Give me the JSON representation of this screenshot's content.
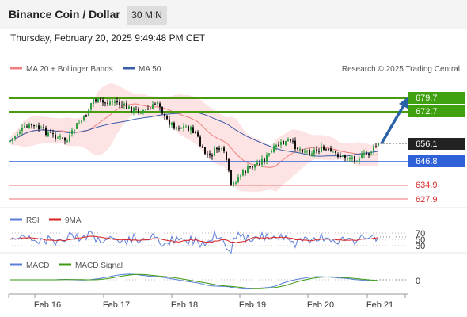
{
  "header": {
    "title": "Binance Coin / Dollar",
    "timeframe": "30 MIN"
  },
  "datetime": "Thursday, February 20, 2025 9:49:48 PM CET",
  "legend": {
    "ma20_label": "MA 20 + Bollinger Bands",
    "ma50_label": "MA 50",
    "credit": "Research © 2025 Trading Central"
  },
  "colors": {
    "up": "#2e9e44",
    "down": "#111111",
    "ma20": "#f08080",
    "ma50": "#3a5ba8",
    "resistance": "#4a9a10",
    "support": "#2f62d8",
    "support_red": "#f4a0a0",
    "arrow": "#2a62a8",
    "rsi": "#5a7dd8",
    "nine_ma": "#d92020",
    "macd": "#5a7dd8",
    "macd_signal": "#3a9a10"
  },
  "chart_data": [
    {
      "type": "candlestick",
      "x_ticks": [
        "Feb 16",
        "Feb 17",
        "Feb 18",
        "Feb 19",
        "Feb 20",
        "Feb 21"
      ],
      "resistance_levels": [
        {
          "label": "679.7",
          "value": 679.7
        },
        {
          "label": "672.7",
          "value": 672.7
        }
      ],
      "current_price": {
        "label": "656.1",
        "value": 656.1
      },
      "support_levels": [
        {
          "label": "646.8",
          "value": 646.8
        },
        {
          "label": "634.9",
          "value": 634.9
        },
        {
          "label": "627.9",
          "value": 627.9
        }
      ],
      "series": [
        {
          "name": "MA 20 + Bollinger Bands"
        },
        {
          "name": "MA 50"
        }
      ]
    },
    {
      "type": "line",
      "series": [
        {
          "name": "RSI"
        },
        {
          "name": "9MA"
        }
      ],
      "y_ticks": [
        "70",
        "50",
        "30"
      ]
    },
    {
      "type": "line",
      "series": [
        {
          "name": "MACD"
        },
        {
          "name": "MACD Signal"
        }
      ],
      "y_ticks": [
        "0"
      ]
    }
  ],
  "rsi_legend": {
    "rsi": "RSI",
    "nine_ma": "9MA"
  },
  "macd_legend": {
    "macd": "MACD",
    "signal": "MACD Signal"
  }
}
